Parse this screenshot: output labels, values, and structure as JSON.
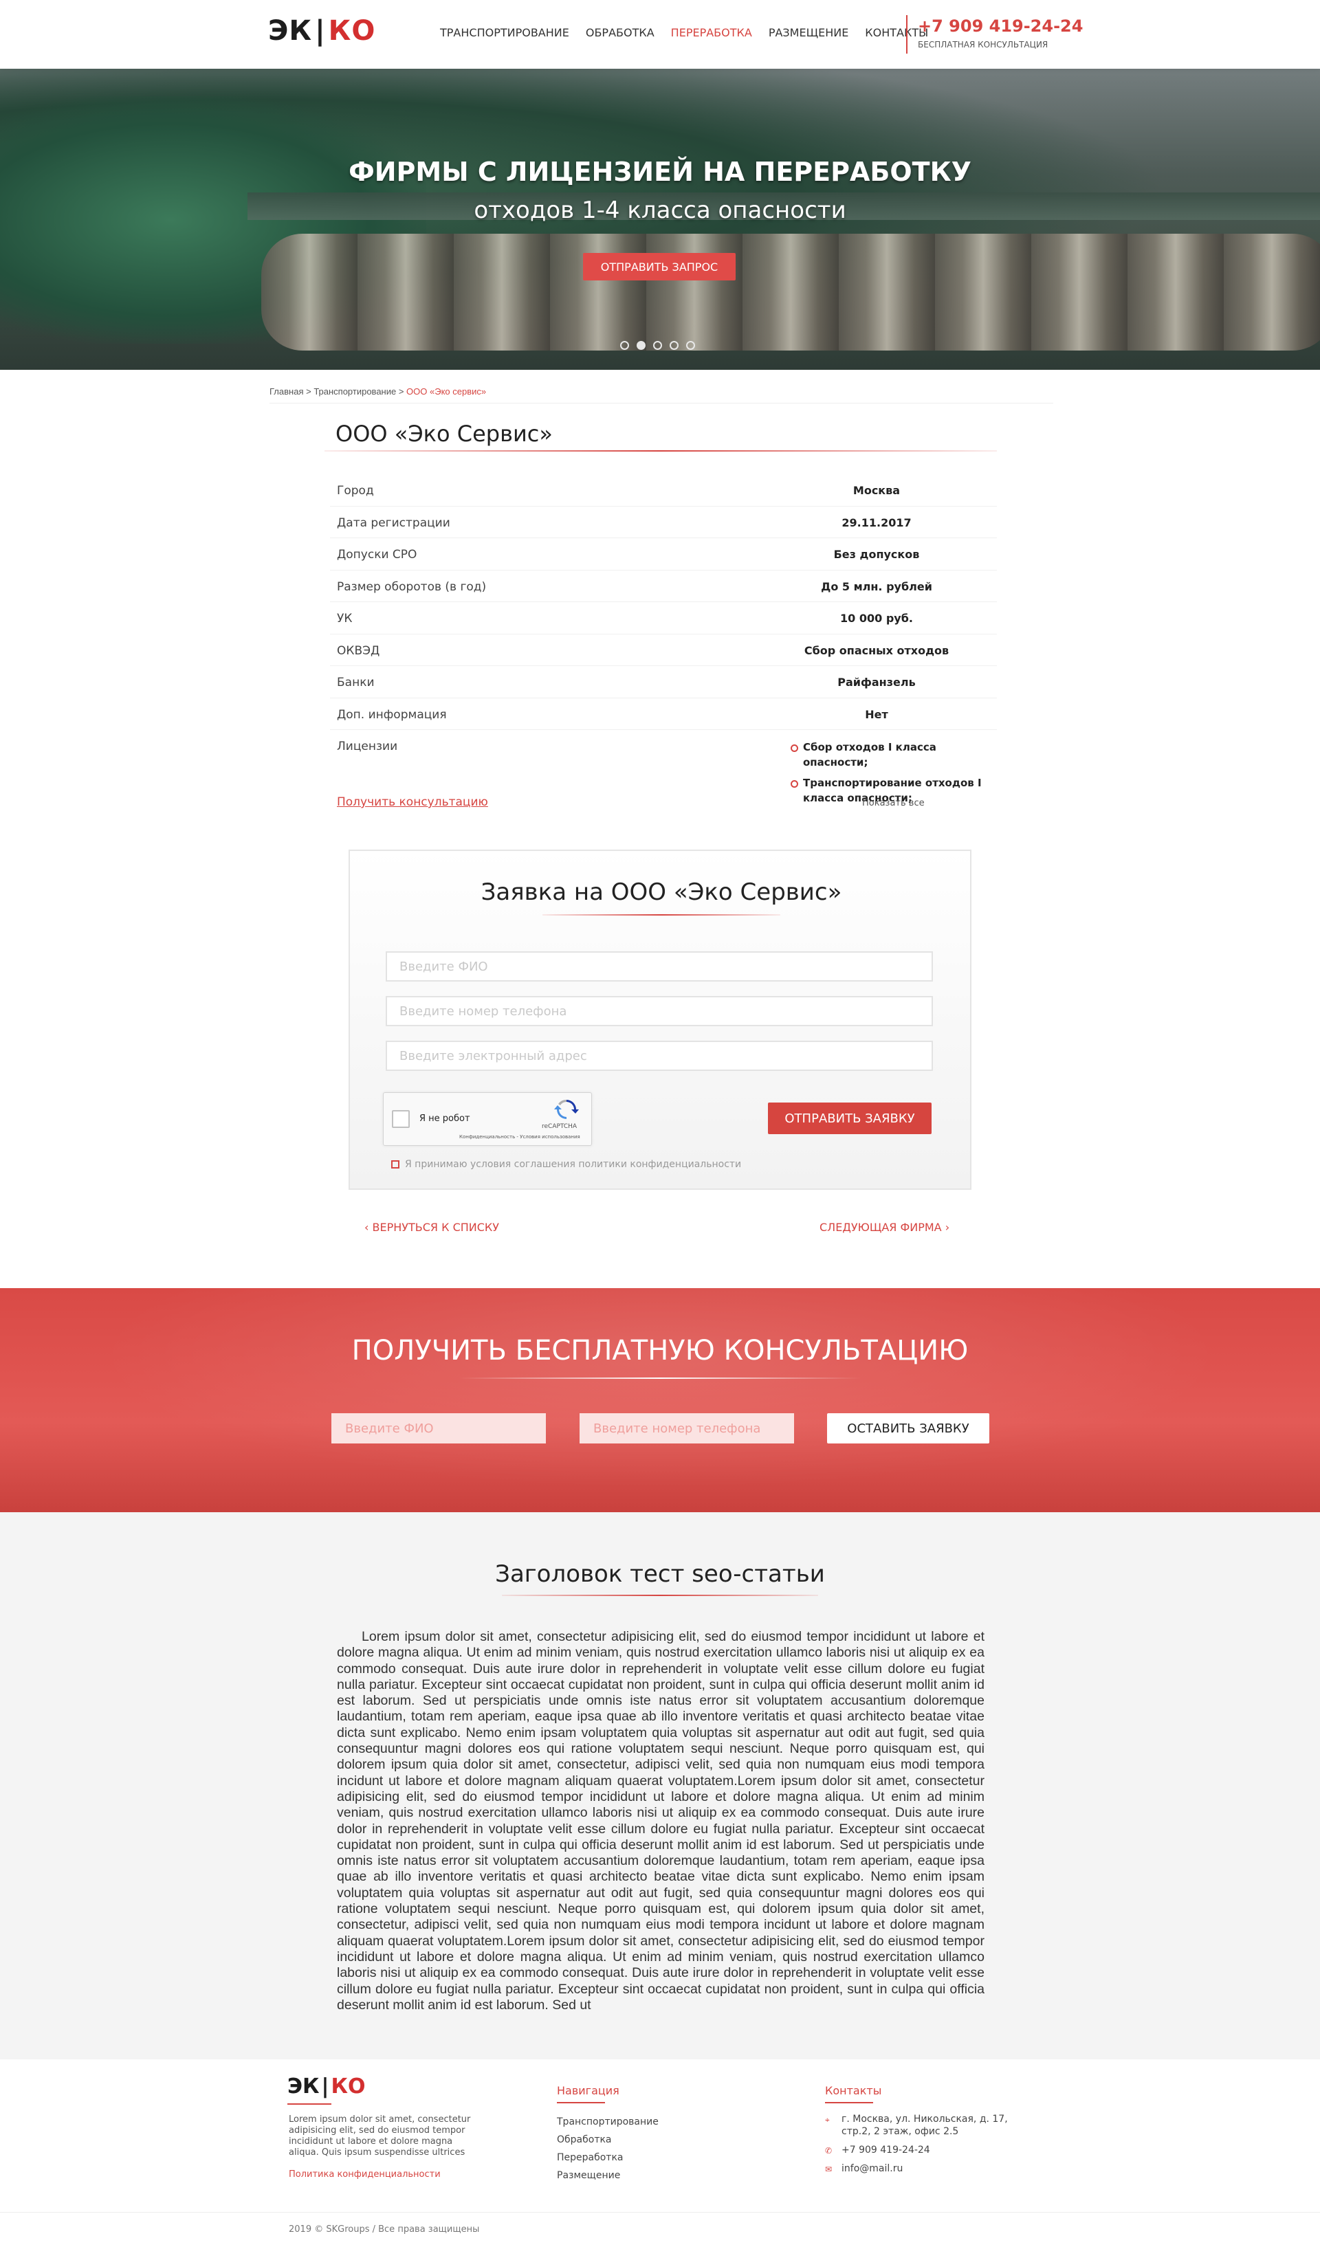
{
  "header": {
    "logo_left": "ЭК",
    "logo_sep": "|",
    "logo_right": "КО",
    "nav": [
      "Транспортирование",
      "Обработка",
      "Переработка",
      "Размещение",
      "Контакты"
    ],
    "active_nav": "Переработка",
    "phone": "+7 909 419-24-24",
    "consult_label": "Бесплатная консультация"
  },
  "hero": {
    "title": "Фирмы с лицензией на переработку",
    "subtitle": "отходов 1-4 класса опасности",
    "button": "Отправить запрос",
    "slides": 5,
    "active_slide": 2
  },
  "breadcrumb": {
    "home": "Главная",
    "sep": " > ",
    "section": "Транспортирование",
    "current": "ООО «Эко сервис»"
  },
  "company": {
    "title": "ООО «Эко Сервис»",
    "rows": [
      {
        "k": "Город",
        "v": "Москва"
      },
      {
        "k": "Дата регистрации",
        "v": "29.11.2017"
      },
      {
        "k": "Допуски СРО",
        "v": "Без допусков"
      },
      {
        "k": "Размер оборотов (в год)",
        "v": "До 5 млн. рублей"
      },
      {
        "k": "УК",
        "v": "10 000 руб."
      },
      {
        "k": "ОКВЭД",
        "v": "Сбор опасных отходов"
      },
      {
        "k": "Банки",
        "v": "Райфанзель"
      },
      {
        "k": "Доп. информация",
        "v": "Нет"
      },
      {
        "k": "Лицензии",
        "v": ""
      }
    ],
    "licenses": [
      "Сбор отходов I класса опасности;",
      "Транспортирование отходов I класса опасности;"
    ],
    "get_consult": "Получить консультацию",
    "show_all": "Показать все"
  },
  "request_form": {
    "title": "Заявка на ООО «Эко Сервис»",
    "name_placeholder": "Введите ФИО",
    "phone_placeholder": "Введите номер телефона",
    "email_placeholder": "Введите электронный адрес",
    "captcha_label": "Я не робот",
    "captcha_brand": "reCAPTCHA",
    "captcha_links": "Конфиденциальность - Условия использования",
    "submit": "Отправить заявку",
    "agree": "Я принимаю условия соглашения политики конфиденциальности"
  },
  "pager": {
    "back": "Вернуться к списку",
    "next": "Следующая фирма"
  },
  "consult": {
    "title": "Получить бесплатную консультацию",
    "name_placeholder": "Введите ФИО",
    "phone_placeholder": "Введите номер телефона",
    "button": "Оставить заявку"
  },
  "seo": {
    "title": "Заголовок тест seo-статьи",
    "text": "Lorem ipsum dolor sit amet, consectetur adipisicing elit, sed do eiusmod tempor incididunt ut labore et dolore magna aliqua. Ut enim ad minim veniam, quis nostrud exercitation ullamco laboris nisi ut aliquip ex ea commodo consequat. Duis aute irure dolor in reprehenderit in voluptate velit esse cillum dolore eu fugiat nulla pariatur. Excepteur sint occaecat cupidatat non proident, sunt in culpa qui officia deserunt mollit anim id est laborum. Sed ut perspiciatis unde omnis iste natus error sit voluptatem accusantium doloremque laudantium, totam rem aperiam, eaque ipsa quae ab illo inventore veritatis et quasi architecto beatae vitae dicta sunt explicabo. Nemo enim ipsam voluptatem quia voluptas sit aspernatur aut odit aut fugit, sed quia consequuntur magni dolores eos qui ratione voluptatem sequi nesciunt. Neque porro quisquam est, qui dolorem ipsum quia dolor sit amet, consectetur, adipisci velit, sed quia non numquam eius modi tempora incidunt ut labore et dolore magnam aliquam quaerat voluptatem.Lorem ipsum dolor sit amet, consectetur adipisicing elit, sed do eiusmod tempor incididunt ut labore et dolore magna aliqua. Ut enim ad minim veniam, quis nostrud exercitation ullamco laboris nisi ut aliquip ex ea commodo consequat. Duis aute irure dolor in reprehenderit in voluptate velit esse cillum dolore eu fugiat nulla pariatur. Excepteur sint occaecat cupidatat non proident, sunt in culpa qui officia deserunt mollit anim id est laborum. Sed ut perspiciatis unde omnis iste natus error sit voluptatem accusantium doloremque laudantium, totam rem aperiam, eaque ipsa quae ab illo inventore veritatis et quasi architecto beatae vitae dicta sunt explicabo. Nemo enim ipsam voluptatem quia voluptas sit aspernatur aut odit aut fugit, sed quia consequuntur magni dolores eos qui ratione voluptatem sequi nesciunt. Neque porro quisquam est, qui dolorem ipsum quia dolor sit amet, consectetur, adipisci velit, sed quia non numquam eius modi tempora incidunt ut labore et dolore magnam aliquam quaerat voluptatem.Lorem ipsum dolor sit amet, consectetur adipisicing elit, sed do eiusmod tempor incididunt ut labore et dolore magna aliqua. Ut enim ad minim veniam, quis nostrud exercitation ullamco laboris nisi ut aliquip ex ea commodo consequat. Duis aute irure dolor in reprehenderit in voluptate velit esse cillum dolore eu fugiat nulla pariatur. Excepteur sint occaecat cupidatat non proident, sunt in culpa qui officia deserunt mollit anim id est laborum. Sed ut"
  },
  "footer": {
    "logo_left": "ЭК",
    "logo_sep": "|",
    "logo_right": "КО",
    "about": "Lorem ipsum dolor sit amet, consectetur adipisicing elit, sed do eiusmod tempor incididunt ut labore et dolore magna aliqua. Quis ipsum suspendisse ultrices",
    "policy": "Политика конфиденциальности",
    "nav_title": "Навигация",
    "nav": [
      "Транспортирование",
      "Обработка",
      "Переработка",
      "Размещение"
    ],
    "contacts_title": "Контакты",
    "address": "г. Москва, ул. Никольская, д. 17, стр.2, 2 этаж, офис 2.5",
    "phone": "+7 909 419-24-24",
    "email": "info@mail.ru",
    "copyright": "2019 © SKGroups / Все права защищены"
  },
  "colors": {
    "accent": "#d64541",
    "band": "#e05450",
    "seo_bg": "#f4f4f4"
  }
}
